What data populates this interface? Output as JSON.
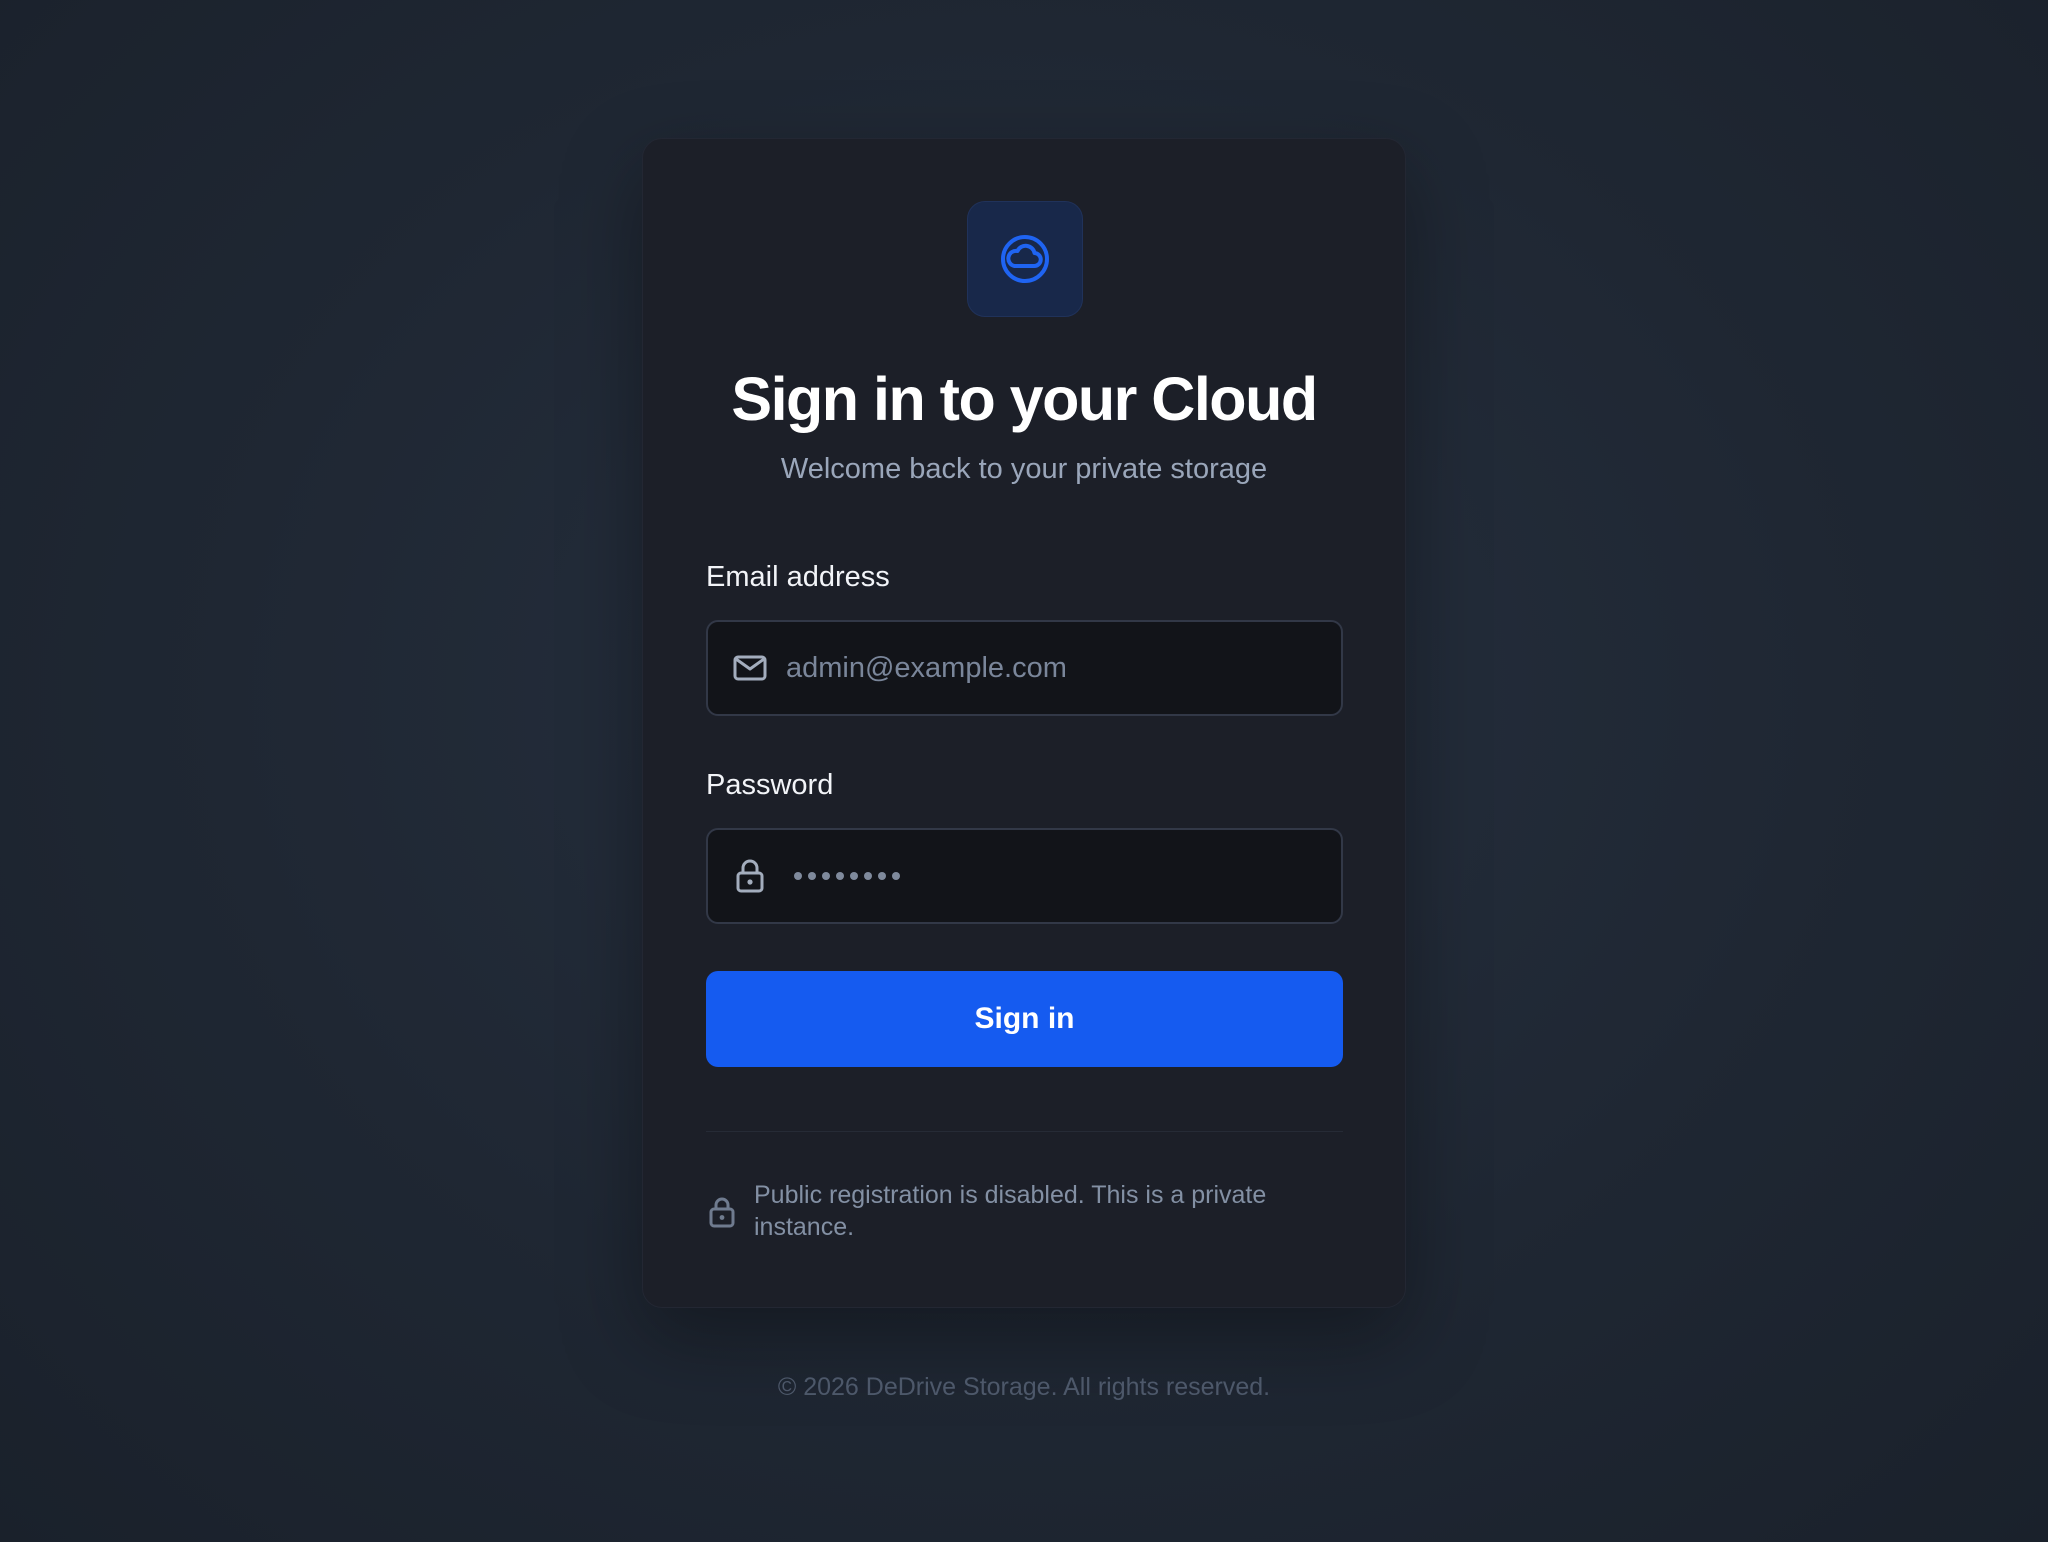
{
  "brand": {
    "logo_icon": "cloud-icon",
    "accent_color": "#155bf0"
  },
  "header": {
    "title": "Sign in to your Cloud",
    "subtitle": "Welcome back to your private storage"
  },
  "form": {
    "email": {
      "label": "Email address",
      "placeholder": "admin@example.com",
      "value": "",
      "icon": "mail-icon"
    },
    "password": {
      "label": "Password",
      "masked_value": "••••••••",
      "icon": "lock-icon"
    },
    "submit_label": "Sign in"
  },
  "notice": {
    "icon": "lock-icon",
    "text": "Public registration is disabled. This is a private instance."
  },
  "footer": {
    "text": "© 2026 DeDrive Storage. All rights reserved."
  }
}
